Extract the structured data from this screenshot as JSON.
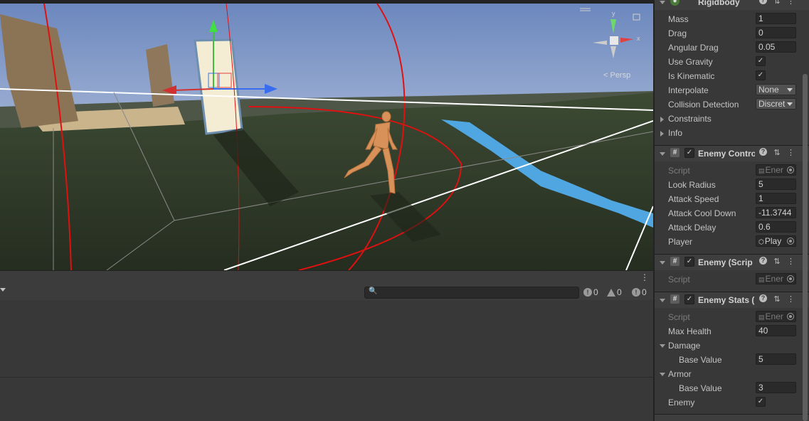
{
  "scene_view": {
    "projection_label": "< Persp",
    "gizmo_axes": [
      "y",
      "x"
    ]
  },
  "console": {
    "counts": {
      "info": "0",
      "warning": "0",
      "error": "0"
    }
  },
  "inspector": {
    "rigidbody": {
      "title": "Rigidbody",
      "mass_label": "Mass",
      "mass": "1",
      "drag_label": "Drag",
      "drag": "0",
      "angular_drag_label": "Angular Drag",
      "angular_drag": "0.05",
      "use_gravity_label": "Use Gravity",
      "is_kinematic_label": "Is Kinematic",
      "interpolate_label": "Interpolate",
      "interpolate": "None",
      "collision_label": "Collision Detection",
      "collision": "Discret",
      "constraints_label": "Constraints",
      "info_label": "Info"
    },
    "enemy_controller": {
      "title": "Enemy Contro",
      "script_label": "Script",
      "script": "Ener",
      "look_radius_label": "Look Radius",
      "look_radius": "5",
      "attack_speed_label": "Attack Speed",
      "attack_speed": "1",
      "attack_cool_down_label": "Attack Cool Down",
      "attack_cool_down": "-11.3744",
      "attack_delay_label": "Attack Delay",
      "attack_delay": "0.6",
      "player_label": "Player",
      "player": "Play"
    },
    "enemy_script": {
      "title": "Enemy (Scrip",
      "script_label": "Script",
      "script": "Ener"
    },
    "enemy_stats": {
      "title": "Enemy Stats (",
      "script_label": "Script",
      "script": "Ener",
      "max_health_label": "Max Health",
      "max_health": "40",
      "damage_label": "Damage",
      "damage_base_label": "Base Value",
      "damage_base": "5",
      "armor_label": "Armor",
      "armor_base_label": "Base Value",
      "armor_base": "3",
      "enemy_label": "Enemy"
    },
    "checkmark": "✓"
  }
}
